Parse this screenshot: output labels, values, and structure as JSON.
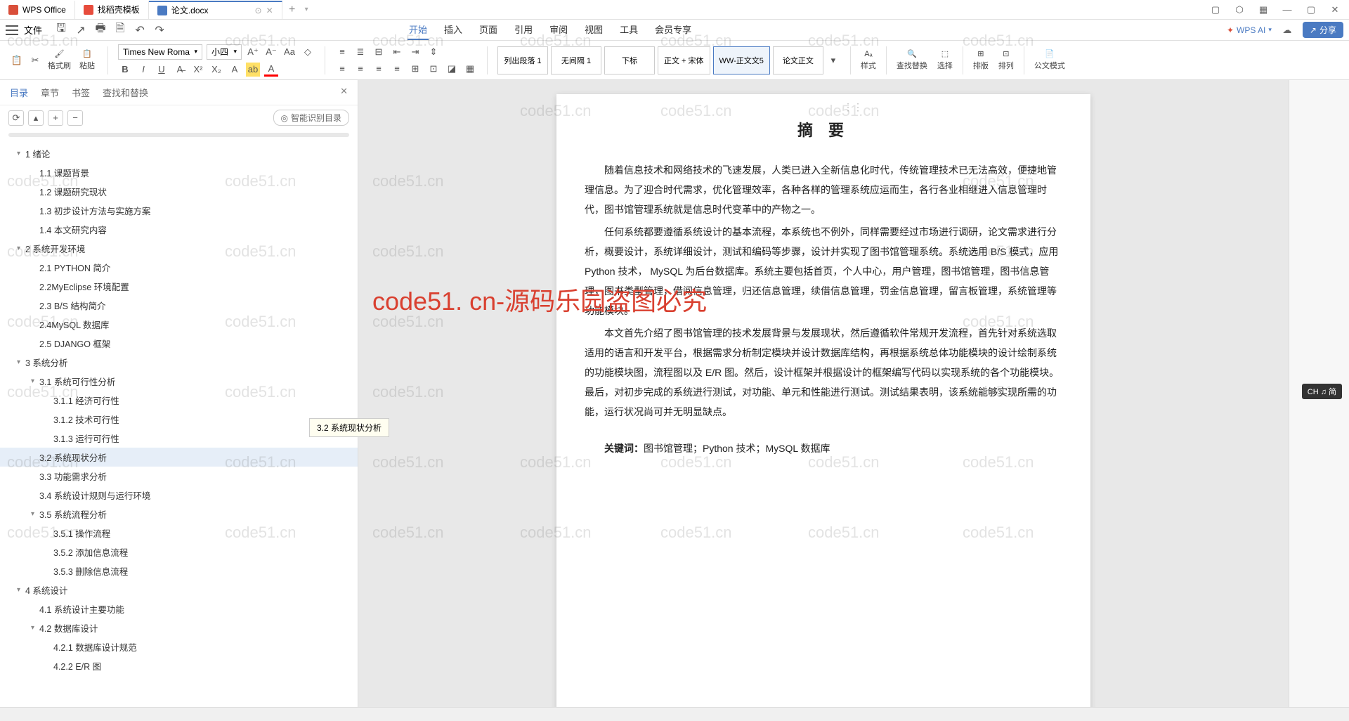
{
  "titlebar": {
    "tabs": [
      {
        "icon": "wps",
        "label": "WPS Office"
      },
      {
        "icon": "template",
        "label": "找稻壳模板"
      },
      {
        "icon": "doc",
        "label": "论文.docx",
        "active": true
      }
    ]
  },
  "menubar": {
    "file": "文件",
    "tabs": [
      "开始",
      "插入",
      "页面",
      "引用",
      "审阅",
      "视图",
      "工具",
      "会员专享"
    ],
    "active_tab": "开始",
    "wps_ai": "WPS AI",
    "share": "分享"
  },
  "ribbon": {
    "format_painter": "格式刷",
    "paste": "粘贴",
    "font_name": "Times New Roma",
    "font_size": "小四",
    "styles": [
      "列出段落 1",
      "无间隔 1",
      "下标",
      "正文 + 宋体",
      "WW-正文文5",
      "论文正文"
    ],
    "style_panel": "样式",
    "find_replace": "查找替换",
    "select": "选择",
    "sort": "排版",
    "arrange": "排列",
    "gov_mode": "公文模式"
  },
  "sidebar": {
    "tabs": [
      "目录",
      "章节",
      "书签",
      "查找和替换"
    ],
    "active_tab": "目录",
    "smart_toc": "智能识别目录",
    "tooltip": "3.2 系统现状分析",
    "toc": [
      {
        "level": 1,
        "label": "1  绪论",
        "expandable": true
      },
      {
        "level": 2,
        "label": "1.1 课题背景"
      },
      {
        "level": 2,
        "label": "1.2 课题研究现状"
      },
      {
        "level": 2,
        "label": "1.3 初步设计方法与实施方案"
      },
      {
        "level": 2,
        "label": "1.4 本文研究内容"
      },
      {
        "level": 1,
        "label": "2  系统开发环境",
        "expandable": true
      },
      {
        "level": 2,
        "label": "2.1 PYTHON 简介"
      },
      {
        "level": 2,
        "label": "2.2MyEclipse 环境配置"
      },
      {
        "level": 2,
        "label": "2.3 B/S 结构简介"
      },
      {
        "level": 2,
        "label": "2.4MySQL 数据库"
      },
      {
        "level": 2,
        "label": "2.5 DJANGO 框架"
      },
      {
        "level": 1,
        "label": "3  系统分析",
        "expandable": true
      },
      {
        "level": 2,
        "label": "3.1  系统可行性分析",
        "expandable": true
      },
      {
        "level": 3,
        "label": "3.1.1 经济可行性"
      },
      {
        "level": 3,
        "label": "3.1.2 技术可行性"
      },
      {
        "level": 3,
        "label": "3.1.3 运行可行性"
      },
      {
        "level": 2,
        "label": "3.2  系统现状分析",
        "selected": true
      },
      {
        "level": 2,
        "label": "3.3  功能需求分析"
      },
      {
        "level": 2,
        "label": "3.4  系统设计规则与运行环境"
      },
      {
        "level": 2,
        "label": "3.5 系统流程分析",
        "expandable": true
      },
      {
        "level": 3,
        "label": "3.5.1 操作流程"
      },
      {
        "level": 3,
        "label": "3.5.2 添加信息流程"
      },
      {
        "level": 3,
        "label": "3.5.3 删除信息流程"
      },
      {
        "level": 1,
        "label": "4  系统设计",
        "expandable": true
      },
      {
        "level": 2,
        "label": "4.1  系统设计主要功能"
      },
      {
        "level": 2,
        "label": "4.2  数据库设计",
        "expandable": true
      },
      {
        "level": 3,
        "label": "4.2.1 数据库设计规范"
      },
      {
        "level": 3,
        "label": "4.2.2 E/R 图"
      }
    ]
  },
  "document": {
    "title": "摘  要",
    "p1": "随着信息技术和网络技术的飞速发展，人类已进入全新信息化时代，传统管理技术已无法高效，便捷地管理信息。为了迎合时代需求，优化管理效率，各种各样的管理系统应运而生，各行各业相继进入信息管理时代，图书馆管理系统就是信息时代变革中的产物之一。",
    "p2": "任何系统都要遵循系统设计的基本流程，本系统也不例外，同样需要经过市场进行调研，论文需求进行分析，概要设计，系统详细设计，测试和编码等步骤，设计并实现了图书馆管理系统。系统选用 B/S 模式，应用 Python 技术， MySQL 为后台数据库。系统主要包括首页，个人中心，用户管理，图书馆管理，图书信息管理，图书类型管理，借阅信息管理，归还信息管理，续借信息管理，罚金信息管理，留言板管理，系统管理等功能模块。",
    "p3": "本文首先介绍了图书馆管理的技术发展背景与发展现状，然后遵循软件常规开发流程，首先针对系统选取适用的语言和开发平台，根据需求分析制定模块并设计数据库结构，再根据系统总体功能模块的设计绘制系统的功能模块图，流程图以及 E/R 图。然后，设计框架并根据设计的框架编写代码以实现系统的各个功能模块。最后，对初步完成的系统进行测试，对功能、单元和性能进行测试。测试结果表明，该系统能够实现所需的功能，运行状况尚可并无明显缺点。",
    "keywords_label": "关键词：",
    "keywords": "图书馆管理；Python 技术；MySQL 数据库"
  },
  "watermarks": {
    "text": "code51.cn",
    "big": "code51. cn-源码乐园盗图必究",
    "ime": "CH ♫ 简"
  }
}
